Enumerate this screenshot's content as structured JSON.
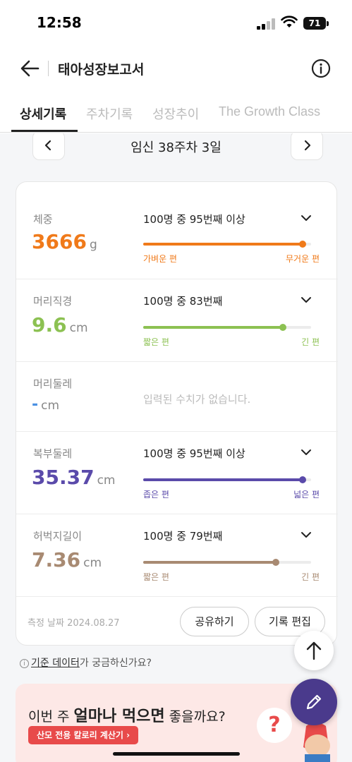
{
  "status": {
    "time": "12:58",
    "battery": "71"
  },
  "header": {
    "title": "태아성장보고서"
  },
  "tabs": [
    {
      "label": "상세기록"
    },
    {
      "label": "주차기록"
    },
    {
      "label": "성장추이"
    },
    {
      "label": "The Growth Class"
    }
  ],
  "week_nav": {
    "label": "임신 38주차 3일"
  },
  "records": [
    {
      "label": "체중",
      "value": "3666",
      "unit": "g",
      "rank": "100명 중 95번째 이상",
      "percentile": 0.95,
      "min_label": "가벼운 편",
      "max_label": "무거운 편",
      "color": "#f07a1a"
    },
    {
      "label": "머리직경",
      "value": "9.6",
      "unit": "cm",
      "rank": "100명 중 83번째",
      "percentile": 0.83,
      "min_label": "짧은 편",
      "max_label": "긴 편",
      "color": "#8cc152"
    },
    {
      "label": "머리둘레",
      "value": "-",
      "unit": "cm",
      "no_data": "입력된 수치가 없습니다.",
      "color": "#4a90e2"
    },
    {
      "label": "복부둘레",
      "value": "35.37",
      "unit": "cm",
      "rank": "100명 중 95번째 이상",
      "percentile": 0.95,
      "min_label": "좁은 편",
      "max_label": "넓은 편",
      "color": "#5a4aaa"
    },
    {
      "label": "허벅지길이",
      "value": "7.36",
      "unit": "cm",
      "rank": "100명 중 79번째",
      "percentile": 0.79,
      "min_label": "짧은 편",
      "max_label": "긴 편",
      "color": "#a88a72"
    }
  ],
  "footer": {
    "measure_date": "측정 날짜 2024.08.27",
    "share_label": "공유하기",
    "edit_label": "기록 편집"
  },
  "help": {
    "link": "기준 데이터",
    "text": "가 궁금하신가요?"
  },
  "banner": {
    "title_pre": "이번 주 ",
    "title_bold": "얼마나 먹으면",
    "title_post": " 좋을까요?",
    "button": "산모 전용 칼로리 계산기"
  },
  "colors": {
    "accent": "#4a3a8c",
    "banner_bg": "#fde8e6",
    "banner_button": "#e84a4a"
  }
}
